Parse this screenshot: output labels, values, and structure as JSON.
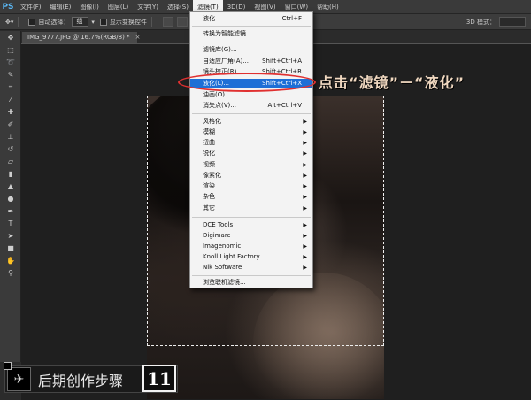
{
  "menubar": {
    "logo": "PS",
    "items": [
      {
        "label": "文件(F)"
      },
      {
        "label": "编辑(E)"
      },
      {
        "label": "图像(I)"
      },
      {
        "label": "图层(L)"
      },
      {
        "label": "文字(Y)"
      },
      {
        "label": "选择(S)"
      },
      {
        "label": "滤镜(T)"
      },
      {
        "label": "3D(D)"
      },
      {
        "label": "视图(V)"
      },
      {
        "label": "窗口(W)"
      },
      {
        "label": "帮助(H)"
      }
    ]
  },
  "optionsbar": {
    "auto_select_label": "自动选择：",
    "auto_select_value": "组",
    "show_transform_label": "显示变换控件",
    "mode_3d_label": "3D 模式："
  },
  "document": {
    "tab_title": "IMG_9777.JPG @ 16.7%(RGB/8) *",
    "close_glyph": "×"
  },
  "filter_menu": {
    "items": [
      {
        "label": "液化",
        "shortcut": "Ctrl+F"
      },
      {
        "label": "转换为智能滤镜",
        "shortcut": ""
      },
      {
        "label": "滤镜库(G)...",
        "shortcut": ""
      },
      {
        "label": "自适应广角(A)...",
        "shortcut": "Shift+Ctrl+A"
      },
      {
        "label": "镜头校正(R)...",
        "shortcut": "Shift+Ctrl+R"
      },
      {
        "label": "液化(L)...",
        "shortcut": "Shift+Ctrl+X"
      },
      {
        "label": "油画(O)...",
        "shortcut": ""
      },
      {
        "label": "消失点(V)...",
        "shortcut": "Alt+Ctrl+V"
      },
      {
        "label": "风格化",
        "shortcut": ""
      },
      {
        "label": "模糊",
        "shortcut": ""
      },
      {
        "label": "扭曲",
        "shortcut": ""
      },
      {
        "label": "锐化",
        "shortcut": ""
      },
      {
        "label": "视频",
        "shortcut": ""
      },
      {
        "label": "像素化",
        "shortcut": ""
      },
      {
        "label": "渲染",
        "shortcut": ""
      },
      {
        "label": "杂色",
        "shortcut": ""
      },
      {
        "label": "其它",
        "shortcut": ""
      },
      {
        "label": "DCE Tools",
        "shortcut": ""
      },
      {
        "label": "Digimarc",
        "shortcut": ""
      },
      {
        "label": "Imagenomic",
        "shortcut": ""
      },
      {
        "label": "Knoll Light Factory",
        "shortcut": ""
      },
      {
        "label": "Nik Software",
        "shortcut": ""
      },
      {
        "label": "浏览联机滤镜...",
        "shortcut": ""
      }
    ],
    "highlighted_index": 5
  },
  "annotation": {
    "callout": "点击“滤镜”－“液化”",
    "ring_color": "#e03030"
  },
  "step_badge": {
    "title": "后期创作步骤",
    "number": "11"
  },
  "colors": {
    "menu_highlight": "#1e6fd6",
    "callout_text": "#f0d8c0"
  }
}
